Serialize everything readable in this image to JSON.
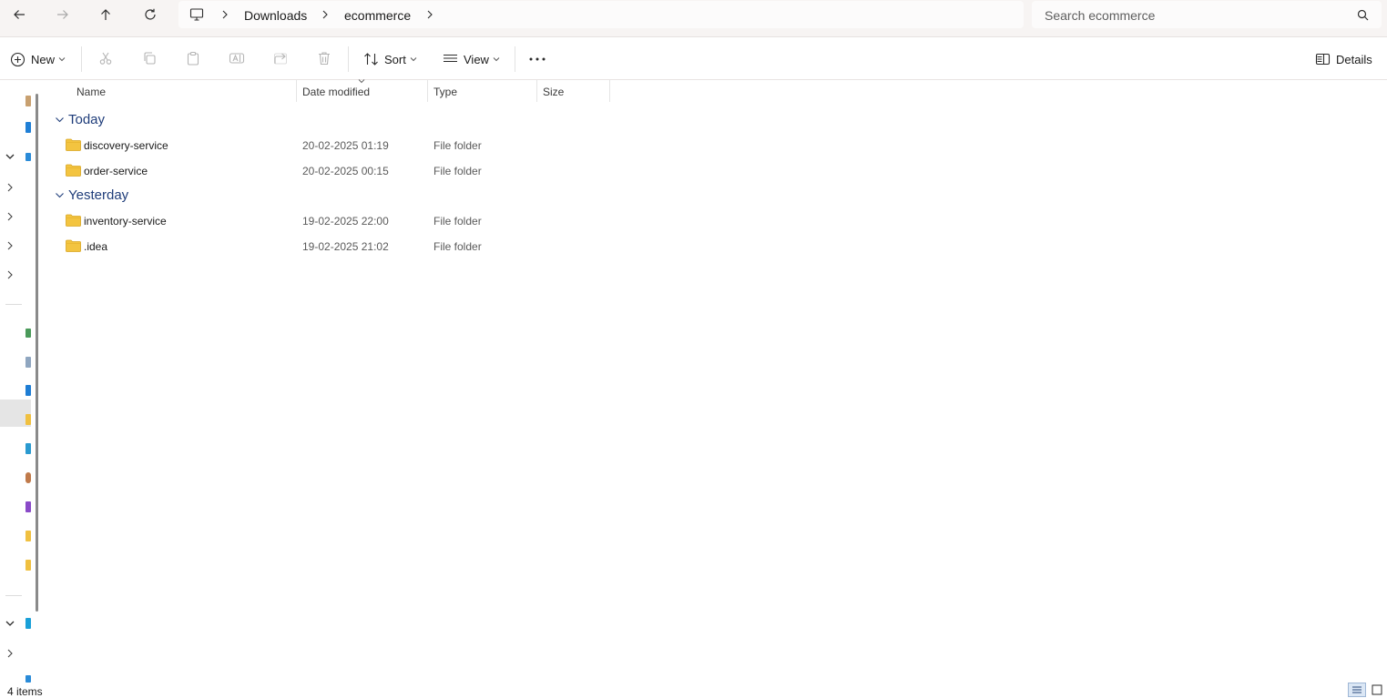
{
  "breadcrumb": {
    "items": [
      "Downloads",
      "ecommerce"
    ]
  },
  "search": {
    "placeholder": "Search ecommerce"
  },
  "toolbar": {
    "new_label": "New",
    "sort_label": "Sort",
    "view_label": "View",
    "details_label": "Details"
  },
  "columns": {
    "name": "Name",
    "date_modified": "Date modified",
    "type": "Type",
    "size": "Size"
  },
  "groups": [
    {
      "label": "Today",
      "rows": [
        {
          "name": "discovery-service",
          "date": "20-02-2025 01:19",
          "type": "File folder"
        },
        {
          "name": "order-service",
          "date": "20-02-2025 00:15",
          "type": "File folder"
        }
      ]
    },
    {
      "label": "Yesterday",
      "rows": [
        {
          "name": "inventory-service",
          "date": "19-02-2025 22:00",
          "type": "File folder"
        },
        {
          "name": ".idea",
          "date": "19-02-2025 21:02",
          "type": "File folder"
        }
      ]
    }
  ],
  "status": {
    "item_count": "4 items"
  },
  "colors": {
    "accent": "#1f3d7a",
    "folder": "#f3c440",
    "selection": "#e5e5e5"
  },
  "icons": [
    "back-arrow-icon",
    "forward-arrow-icon",
    "up-arrow-icon",
    "refresh-icon",
    "this-pc-icon",
    "search-icon",
    "new-plus-icon",
    "cut-icon",
    "copy-icon",
    "paste-icon",
    "rename-icon",
    "share-icon",
    "delete-icon",
    "sort-icon",
    "view-icon",
    "more-icon",
    "details-pane-icon",
    "folder-icon"
  ]
}
